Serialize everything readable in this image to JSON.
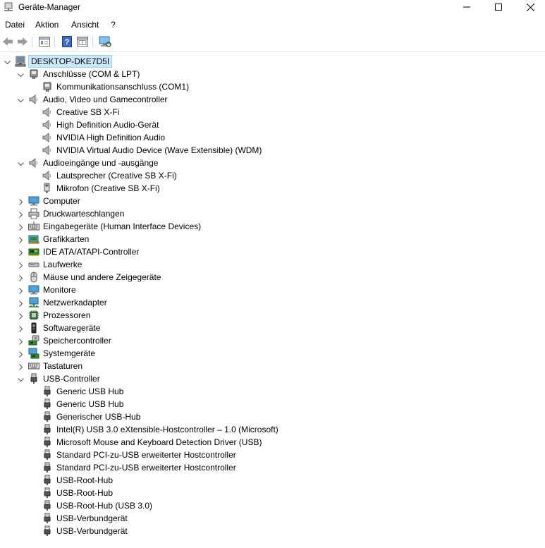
{
  "window": {
    "title": "Geräte-Manager"
  },
  "menu": [
    "Datei",
    "Aktion",
    "Ansicht",
    "?"
  ],
  "tree": {
    "root": "DESKTOP-DKE7D5I",
    "categories": [
      {
        "label": "Anschlüsse (COM & LPT)",
        "icon": "port-icon",
        "expanded": true,
        "children": [
          {
            "label": "Kommunikationsanschluss (COM1)",
            "icon": "port-icon"
          }
        ]
      },
      {
        "label": "Audio, Video und Gamecontroller",
        "icon": "speaker-icon",
        "expanded": true,
        "children": [
          {
            "label": "Creative SB X-Fi",
            "icon": "speaker-icon"
          },
          {
            "label": "High Definition Audio-Gerät",
            "icon": "speaker-icon"
          },
          {
            "label": "NVIDIA High Definition Audio",
            "icon": "speaker-icon"
          },
          {
            "label": "NVIDIA Virtual Audio Device (Wave Extensible) (WDM)",
            "icon": "speaker-icon"
          }
        ]
      },
      {
        "label": "Audioeingänge und -ausgänge",
        "icon": "speaker-icon",
        "expanded": true,
        "children": [
          {
            "label": "Lautsprecher (Creative SB X-Fi)",
            "icon": "speaker-icon"
          },
          {
            "label": "Mikrofon (Creative SB X-Fi)",
            "icon": "microphone-icon"
          }
        ]
      },
      {
        "label": "Computer",
        "icon": "monitor-icon",
        "expanded": false
      },
      {
        "label": "Druckwarteschlangen",
        "icon": "printer-icon",
        "expanded": false
      },
      {
        "label": "Eingabegeräte (Human Interface Devices)",
        "icon": "keyboard-hid-icon",
        "expanded": false
      },
      {
        "label": "Grafikkarten",
        "icon": "display-adapter-icon",
        "expanded": false
      },
      {
        "label": "IDE ATA/ATAPI-Controller",
        "icon": "ide-controller-icon",
        "expanded": false
      },
      {
        "label": "Laufwerke",
        "icon": "drive-icon",
        "expanded": false
      },
      {
        "label": "Mäuse und andere Zeigegeräte",
        "icon": "mouse-icon",
        "expanded": false
      },
      {
        "label": "Monitore",
        "icon": "monitor-icon",
        "expanded": false
      },
      {
        "label": "Netzwerkadapter",
        "icon": "network-adapter-icon",
        "expanded": false
      },
      {
        "label": "Prozessoren",
        "icon": "processor-icon",
        "expanded": false
      },
      {
        "label": "Softwaregeräte",
        "icon": "software-device-icon",
        "expanded": false
      },
      {
        "label": "Speichercontroller",
        "icon": "storage-controller-icon",
        "expanded": false
      },
      {
        "label": "Systemgeräte",
        "icon": "system-device-icon",
        "expanded": false
      },
      {
        "label": "Tastaturen",
        "icon": "keyboard-icon",
        "expanded": false
      },
      {
        "label": "USB-Controller",
        "icon": "usb-icon",
        "expanded": true,
        "children": [
          {
            "label": "Generic USB Hub",
            "icon": "usb-icon"
          },
          {
            "label": "Generic USB Hub",
            "icon": "usb-icon"
          },
          {
            "label": "Generischer USB-Hub",
            "icon": "usb-icon"
          },
          {
            "label": "Intel(R) USB 3.0 eXtensible-Hostcontroller – 1.0 (Microsoft)",
            "icon": "usb-icon"
          },
          {
            "label": "Microsoft Mouse and Keyboard Detection Driver (USB)",
            "icon": "usb-icon"
          },
          {
            "label": "Standard PCI-zu-USB erweiterter Hostcontroller",
            "icon": "usb-icon"
          },
          {
            "label": "Standard PCI-zu-USB erweiterter Hostcontroller",
            "icon": "usb-icon"
          },
          {
            "label": "USB-Root-Hub",
            "icon": "usb-icon"
          },
          {
            "label": "USB-Root-Hub",
            "icon": "usb-icon"
          },
          {
            "label": "USB-Root-Hub (USB 3.0)",
            "icon": "usb-icon"
          },
          {
            "label": "USB-Verbundgerät",
            "icon": "usb-icon"
          },
          {
            "label": "USB-Verbundgerät",
            "icon": "usb-icon"
          }
        ]
      }
    ]
  }
}
